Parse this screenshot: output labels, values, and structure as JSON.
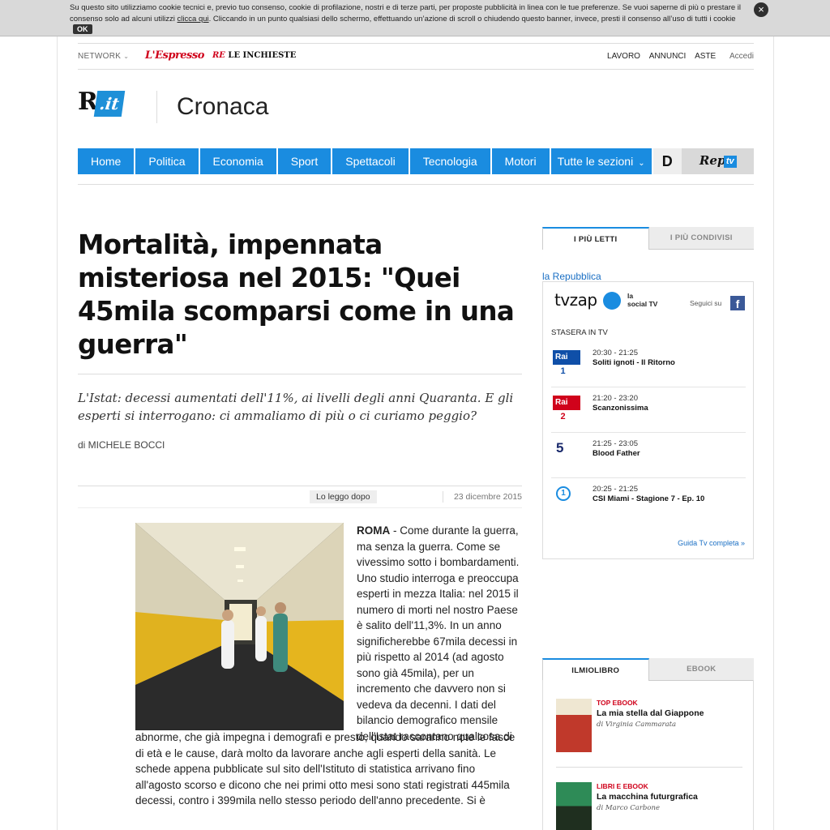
{
  "cookie": {
    "text_before": "Su questo sito utilizziamo cookie tecnici e, previo tuo consenso, cookie di profilazione, nostri e di terze parti, per proposte pubblicità in linea con le tue preferenze. Se vuoi saperne di più o prestare il consenso solo ad alcuni utilizzi ",
    "link": "clicca qui",
    "text_after": ". Cliccando in un punto qualsiasi dello schermo, effettuando un’azione di scroll o chiudendo questo banner, invece, presti il consenso all’uso di tutti i cookie",
    "ok": "OK",
    "close_icon": "×"
  },
  "network": {
    "label": "NETWORK",
    "chevron": "⌄",
    "espresso": "L'Espresso",
    "inchieste_re": "RE",
    "inchieste": "LE INCHIESTE",
    "links": [
      "LAVORO",
      "ANNUNCI",
      "ASTE"
    ],
    "login": "Accedi"
  },
  "header": {
    "logo_r": "R",
    "logo_it": ".it",
    "section": "Cronaca"
  },
  "nav": {
    "items": [
      "Home",
      "Politica",
      "Economia",
      "Sport",
      "Spettacoli",
      "Tecnologia",
      "Motori"
    ],
    "all_sections": "Tutte le sezioni",
    "chevron": "⌄",
    "d_label": "D",
    "rep_label": "Rep",
    "tv_label": "tv"
  },
  "article": {
    "headline": "Mortalità, impennata misteriosa nel 2015: \"Quei 45mila scomparsi come in una guerra\"",
    "summary": "L'Istat: decessi aumentati dell'11%, ai livelli degli anni Quaranta. E gli esperti si interrogano: ci ammaliamo di più o ci curiamo peggio?",
    "byline": "di MICHELE BOCCI",
    "read_later": "Lo leggo dopo",
    "date": "23 dicembre 2015",
    "city": "ROMA",
    "body_side": " - Come durante la guerra, ma senza la guerra. Come se vivessimo sotto i bombardamenti. Uno studio interroga e preoccupa esperti in mezza Italia: nel 2015 il numero di morti nel nostro Paese è salito dell'11,3%. In un anno significherebbe 67mila decessi in più rispetto al 2014 (ad agosto sono già 45mila), per un incremento che davvero non si vedeva da decenni. I dati del bilancio demografico mensile dell'Istat raccontano qualcosa di",
    "body_full": "abnorme, che già impegna i demografi e presto, quando saranno note le fasce di età e le cause, darà molto da lavorare anche agli esperti della sanità. Le schede appena pubblicate sul sito dell'Istituto di statistica arrivano fino all'agosto scorso e dicono che nei primi otto mesi sono stati registrati 445mila decessi, contro i 399mila nello stesso periodo dell'anno precedente. Si è"
  },
  "sidebar": {
    "tabs": [
      "I PIÙ LETTI",
      "I PIÙ CONDIVISI"
    ],
    "source": "la Repubblica",
    "tv": {
      "brand": "tvzap",
      "tagline_1": "la",
      "tagline_2": "social TV",
      "follow": "Seguici su",
      "fb_icon": "f",
      "tonight": "STASERA IN TV",
      "programs": [
        {
          "channel_name": "Rai",
          "channel_num": "1",
          "time": "20:30 - 21:25",
          "title": "Soliti ignoti - Il Ritorno"
        },
        {
          "channel_name": "Rai",
          "channel_num": "2",
          "time": "21:20 - 23:20",
          "title": "Scanzonissima"
        },
        {
          "channel_name": "5",
          "channel_num": "",
          "time": "21:25 - 23:05",
          "title": "Blood Father"
        },
        {
          "channel_name": "1",
          "channel_num": "",
          "time": "20:25 - 21:25",
          "title": "CSI Miami - Stagione 7 - Ep. 10"
        }
      ],
      "guide_link": "Guida Tv completa »"
    },
    "book_tabs": [
      "ILMIOLIBRO",
      "EBOOK"
    ],
    "books": [
      {
        "category": "TOP EBOOK",
        "title": "La mia stella dal Giappone",
        "author": "di Virginia Cammarata",
        "cover_color": "#c0392b"
      },
      {
        "category": "LIBRI E EBOOK",
        "title": "La macchina futurgrafica",
        "author": "di Marco Carbone",
        "cover_color": "#2e8b57"
      }
    ]
  }
}
